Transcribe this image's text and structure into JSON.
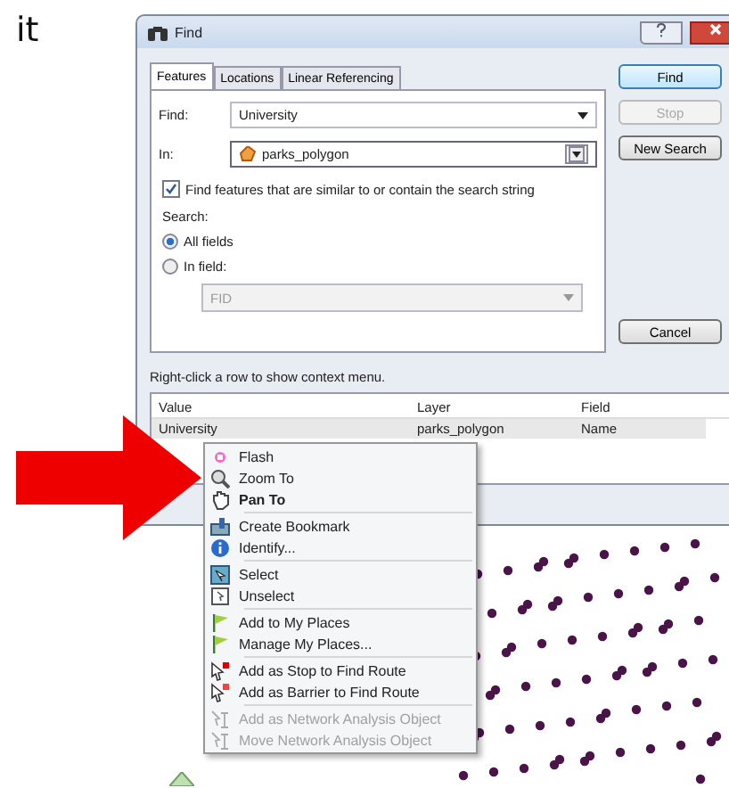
{
  "slide_text": "it",
  "window": {
    "title": "Find"
  },
  "tabs": [
    {
      "label": "Features",
      "selected": true
    },
    {
      "label": "Locations",
      "selected": false
    },
    {
      "label": "Linear Referencing",
      "selected": false
    }
  ],
  "find_field": {
    "label": "Find:",
    "value": "University"
  },
  "in_field": {
    "label": "In:",
    "value": "parks_polygon"
  },
  "similar_checkbox": {
    "label": "Find features that are similar to or contain the search string",
    "checked": true
  },
  "search": {
    "label": "Search:",
    "options": [
      {
        "label": "All fields",
        "selected": true
      },
      {
        "label": "In field:",
        "selected": false
      }
    ]
  },
  "field_dropdown": {
    "value": "FID",
    "disabled": true
  },
  "buttons": [
    {
      "label": "Find",
      "disabled": false,
      "default": true
    },
    {
      "label": "Stop",
      "disabled": true,
      "default": false
    },
    {
      "label": "New Search",
      "disabled": false,
      "default": false
    }
  ],
  "cancel_button": {
    "label": "Cancel"
  },
  "hint": "Right-click a row to show context menu.",
  "table": {
    "columns": [
      "Value",
      "Layer",
      "Field"
    ],
    "rows": [
      [
        "University",
        "parks_polygon",
        "Name"
      ]
    ]
  },
  "context_menu": [
    {
      "kind": "item",
      "label": "Flash",
      "bold": false,
      "disabled": false
    },
    {
      "kind": "item",
      "label": "Zoom To",
      "bold": false,
      "disabled": false
    },
    {
      "kind": "item",
      "label": "Pan To",
      "bold": true,
      "disabled": false
    },
    {
      "kind": "separator"
    },
    {
      "kind": "item",
      "label": "Create Bookmark",
      "bold": false,
      "disabled": false
    },
    {
      "kind": "item",
      "label": "Identify...",
      "bold": false,
      "disabled": false
    },
    {
      "kind": "separator"
    },
    {
      "kind": "item",
      "label": "Select",
      "bold": false,
      "disabled": false
    },
    {
      "kind": "item",
      "label": "Unselect",
      "bold": false,
      "disabled": false
    },
    {
      "kind": "separator"
    },
    {
      "kind": "item",
      "label": "Add to My Places",
      "bold": false,
      "disabled": false
    },
    {
      "kind": "item",
      "label": "Manage My Places...",
      "bold": false,
      "disabled": false
    },
    {
      "kind": "separator"
    },
    {
      "kind": "item",
      "label": "Add as Stop to Find Route",
      "bold": false,
      "disabled": false
    },
    {
      "kind": "item",
      "label": "Add as Barrier to Find Route",
      "bold": false,
      "disabled": false
    },
    {
      "kind": "separator"
    },
    {
      "kind": "item",
      "label": "Add as Network Analysis Object",
      "bold": false,
      "disabled": true
    },
    {
      "kind": "item",
      "label": "Move Network Analysis Object",
      "bold": false,
      "disabled": true
    }
  ]
}
